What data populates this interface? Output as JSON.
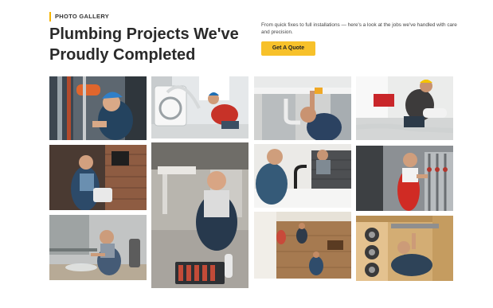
{
  "section": {
    "eyebrow": "PHOTO GALLERY",
    "title": "Plumbing Projects We've Proudly Completed",
    "intro": "From quick fixes to full installations — here's a look at the jobs we've handled with care and precision.",
    "cta_label": "Get A Quote"
  },
  "colors": {
    "accent": "#f5b400",
    "button": "#f7c12a",
    "heading": "#2a2a2a"
  },
  "gallery": {
    "photos": [
      "plumber-with-hard-hat-at-pipes",
      "plumber-fixing-washing-machine-hose",
      "plumber-under-kitchen-sink",
      "plumber-kneeling-at-water-heater",
      "plumber-holding-bucket-in-brick-room",
      "plumber-with-toolbox-on-floor",
      "plumber-fixing-kitchen-faucet",
      "plumber-in-red-overalls-at-manifold",
      "plumber-repairing-pipe-spray",
      "aerial-view-workers-in-room",
      "plumber-lying-under-cabinet"
    ]
  }
}
